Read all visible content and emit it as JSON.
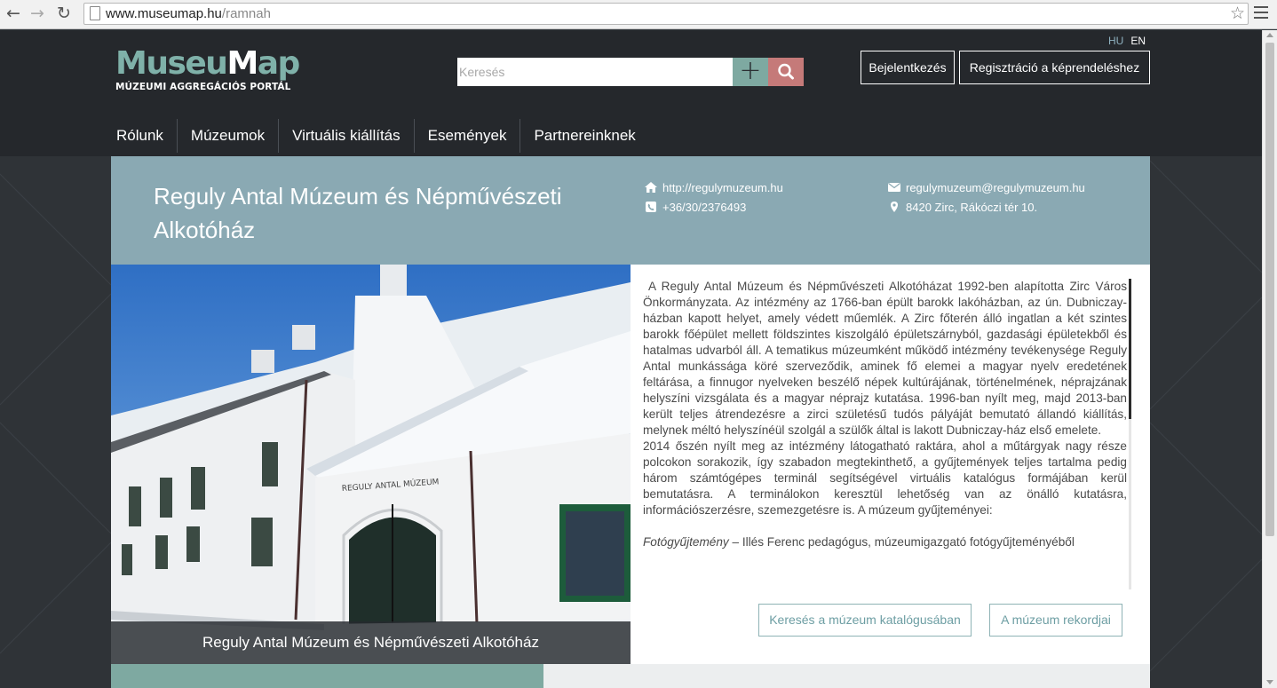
{
  "browser": {
    "url_host": "www.museumap.hu",
    "url_path": "/ramnah"
  },
  "header": {
    "logo_part1": "Museu",
    "logo_part2": "M",
    "logo_part3": "ap",
    "logo_subtitle": "MÚZEUMI AGGREGÁCIÓS PORTÁL",
    "lang_hu": "HU",
    "lang_en": "EN",
    "search_placeholder": "Keresés",
    "login_label": "Bejelentkezés",
    "register_label": "Regisztráció a képrendeléshez"
  },
  "nav": [
    "Rólunk",
    "Múzeumok",
    "Virtuális kiállítás",
    "Események",
    "Partnereinknek"
  ],
  "museum": {
    "title": "Reguly Antal Múzeum és Népművészeti Alkotóház",
    "website": "http://regulymuzeum.hu",
    "phone": "+36/30/2376493",
    "email": "regulymuzeum@regulymuzeum.hu",
    "address": "8420 Zirc, Rákóczi tér 10.",
    "photo_caption": "Reguly Antal Múzeum és Népművészeti Alkotóház",
    "building_sign": "REGULY ANTAL MÚZEUM",
    "description_p1": "A Reguly Antal Múzeum és Népművészeti Alkotóházat 1992-ben alapította Zirc Város Önkormányzata. Az intézmény az 1766-ban épült barokk lakóházban, az ún. Dubniczay-házban kapott helyet, amely védett műemlék. A Zirc főterén álló ingatlan a két szintes barokk főépület mellett földszintes kiszolgáló épületszárnyból, gazdasági épületekből és hatalmas udvarból áll. A tematikus múzeumként működő intézmény tevékenysége Reguly Antal munkássága köré szerveződik, aminek fő elemei a magyar nyelv eredetének feltárása, a finnugor nyelveken beszélő népek kultúrájának, történelmének, néprajzának helyszíni vizsgálata és a magyar néprajz kutatása. 1996-ban nyílt meg, majd 2013-ban került teljes átrendezésre a zirci születésű tudós pályáját bemutató állandó kiállítás, melynek méltó helyszínéül szolgál a szülők által is lakott Dubniczay-ház első emelete.",
    "description_p2": "2014 őszén nyílt meg az intézmény látogatható raktára, ahol a műtárgyak nagy része polcokon sorakozik, így szabadon megtekinthető, a gyűjtemények teljes tartalma pedig három számtógépes terminál segítségével virtuális katalógus formájában kerül bemutatásra. A terminálokon keresztül lehetőség van az önálló kutatásra, információszerzésre, szemezgetésre is. A múzeum gyűjteményei:",
    "description_p3_label": "Fotógyűjtemény",
    "description_p3_text": " – Illés Ferenc pedagógus, múzeumigazgató fotógyűjteményéből",
    "catalog_button": "Keresés a múzeum katalógusában",
    "records_button": "A múzeum rekordjai"
  },
  "colors": {
    "header_bg": "#25282c",
    "teal": "#7ea9a1",
    "rose": "#c57a79",
    "museum_head_bg": "#8aa9b3"
  }
}
